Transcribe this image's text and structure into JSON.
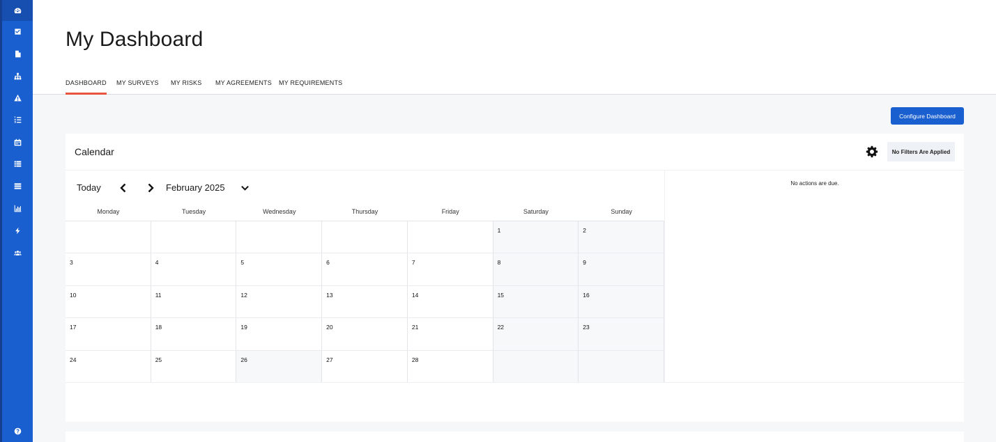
{
  "colors": {
    "sidebar": "#1a5fcf",
    "accent_tab": "#e8553e",
    "primary_button": "#1a5fcf"
  },
  "sidebar": {
    "items": [
      {
        "icon": "dashboard-gauge-icon"
      },
      {
        "icon": "checkbox-icon"
      },
      {
        "icon": "document-icon"
      },
      {
        "icon": "org-chart-icon"
      },
      {
        "icon": "warning-icon"
      },
      {
        "icon": "list-ordered-icon"
      },
      {
        "icon": "calendar-icon"
      },
      {
        "icon": "list-icon"
      },
      {
        "icon": "card-list-icon"
      },
      {
        "icon": "bar-chart-icon"
      },
      {
        "icon": "bolt-icon"
      },
      {
        "icon": "users-icon"
      },
      {
        "icon": "help-icon"
      }
    ]
  },
  "header": {
    "title": "My Dashboard",
    "tabs": [
      {
        "label": "DASHBOARD",
        "active": true
      },
      {
        "label": "MY SURVEYS"
      },
      {
        "label": "MY RISKS"
      },
      {
        "label": "MY AGREEMENTS"
      },
      {
        "label": "MY REQUIREMENTS"
      }
    ]
  },
  "toolbar": {
    "configure_label": "Configure Dashboard"
  },
  "calendar": {
    "title": "Calendar",
    "filter_badge": "No Filters Are Applied",
    "today_label": "Today",
    "month_label": "February 2025",
    "weekdays": [
      "Monday",
      "Tuesday",
      "Wednesday",
      "Thursday",
      "Friday",
      "Saturday",
      "Sunday"
    ],
    "weeks": [
      [
        "",
        "",
        "",
        "",
        "",
        "1",
        "2"
      ],
      [
        "3",
        "4",
        "5",
        "6",
        "7",
        "8",
        "9"
      ],
      [
        "10",
        "11",
        "12",
        "13",
        "14",
        "15",
        "16"
      ],
      [
        "17",
        "18",
        "19",
        "20",
        "21",
        "22",
        "23"
      ],
      [
        "24",
        "25",
        "26",
        "27",
        "28",
        "",
        ""
      ]
    ],
    "no_actions_text": "No actions are due."
  }
}
